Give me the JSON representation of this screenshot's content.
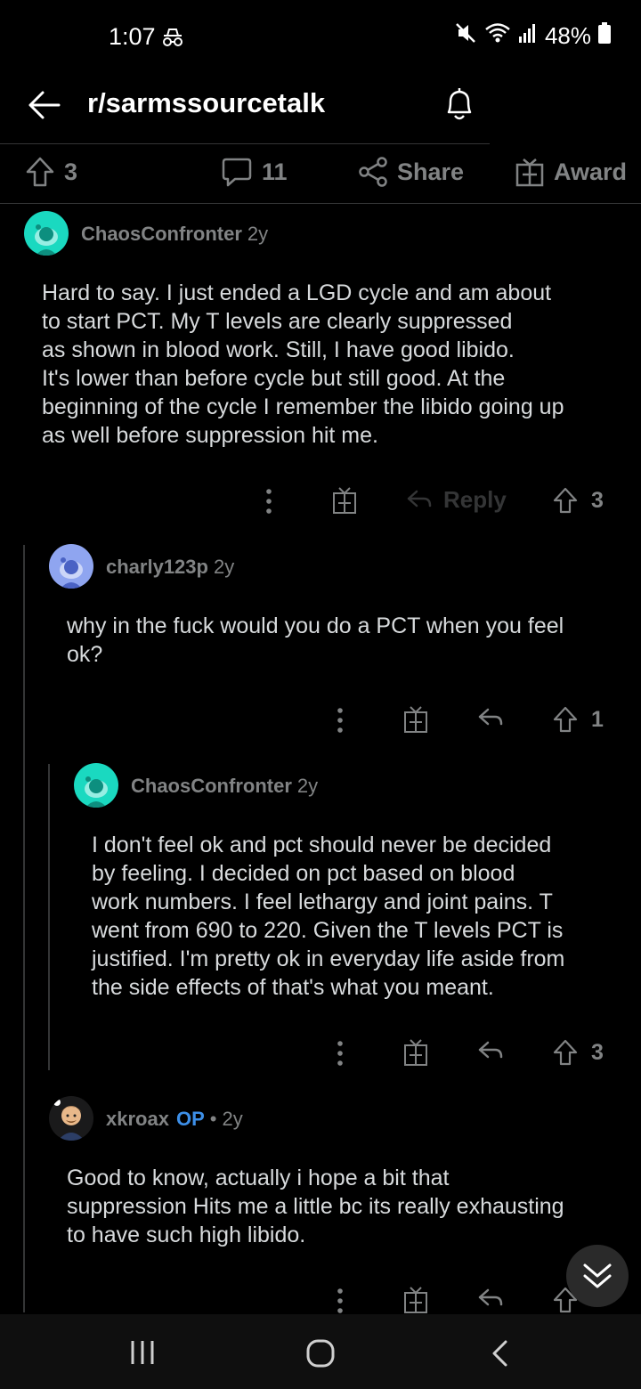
{
  "status": {
    "time": "1:07",
    "battery": "48%",
    "icons": [
      "incognito-icon",
      "mute-icon",
      "wifi-icon",
      "signal-icon",
      "battery-icon"
    ]
  },
  "header": {
    "title": "r/sarmssourcetalk"
  },
  "post_actions": {
    "upvotes": "3",
    "comments": "11",
    "share_label": "Share",
    "award_label": "Award"
  },
  "comments": [
    {
      "username": "ChaosConfronter",
      "age": "2y",
      "lines": [
        "Hard to say. I just ended a LGD cycle and am about",
        "to start PCT. My T levels are clearly suppressed",
        "as shown in blood work. Still, I have good libido.",
        "It's lower than before cycle but still good. At the",
        "beginning of the cycle I remember the libido going up",
        "as well before suppression hit me."
      ],
      "reply_label": "Reply",
      "votes": "3"
    },
    {
      "username": "charly123p",
      "age": "2y",
      "lines": [
        "why in the fuck would you do a PCT when you feel",
        "ok?"
      ],
      "votes": "1"
    },
    {
      "username": "ChaosConfronter",
      "age": "2y",
      "lines": [
        "I don't feel ok and pct should never be decided",
        "by feeling. I decided on pct based on blood",
        "work numbers. I feel lethargy and joint pains. T",
        "went from 690 to 220. Given the T levels PCT is",
        "justified. I'm pretty ok in everyday life aside from",
        "the side effects of that's what you meant."
      ],
      "votes": "3"
    },
    {
      "username": "xkroax",
      "op_badge": "OP",
      "separator": "•",
      "age": "2y",
      "lines": [
        "Good to know, actually i hope a bit that",
        "suppression Hits me a little bc its really exhausting",
        "to have such high libido."
      ]
    }
  ],
  "colors": {
    "background": "#000000",
    "text": "#d7dadc",
    "muted": "#818384",
    "op_blue": "#3d8fe8",
    "avatar_teal": "#1ad9c0",
    "avatar_periwinkle": "#8fa5f0"
  }
}
